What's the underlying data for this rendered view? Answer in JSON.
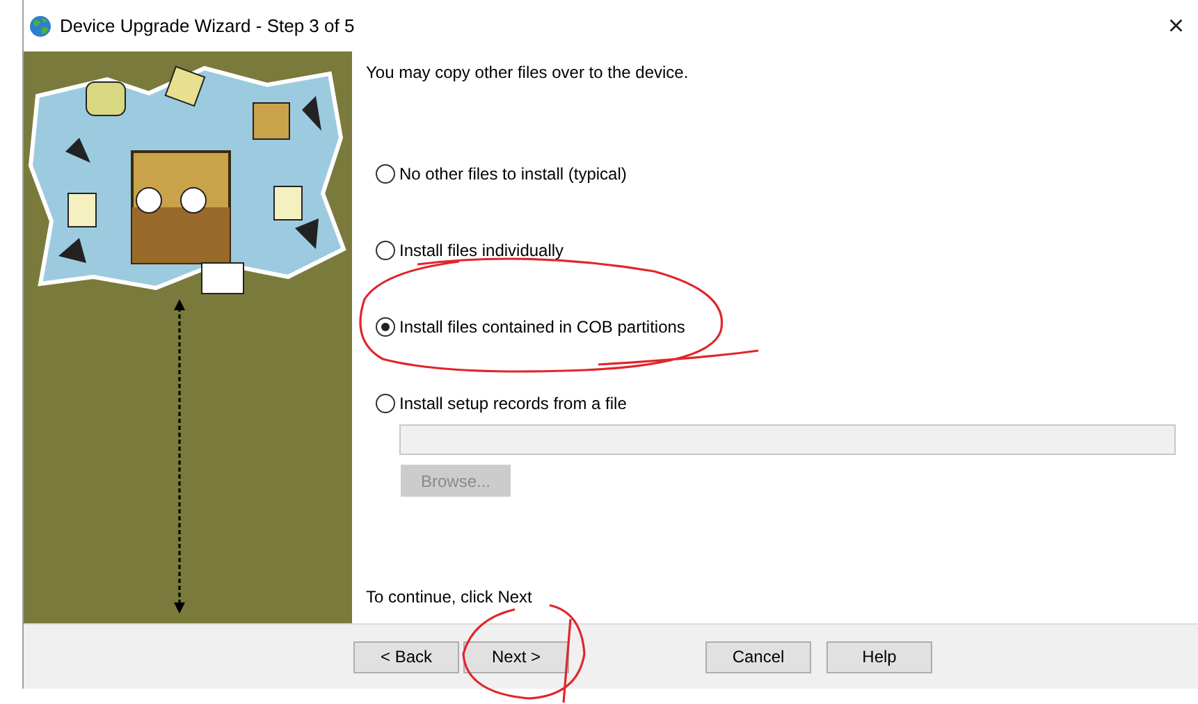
{
  "window": {
    "title": "Device Upgrade Wizard - Step 3 of 5",
    "close": "×"
  },
  "intro": "You may copy other files over to the device.",
  "options": [
    {
      "label": "No other files to install (typical)",
      "selected": false
    },
    {
      "label": "Install files individually",
      "selected": false
    },
    {
      "label": "Install files contained in COB partitions",
      "selected": true
    },
    {
      "label": "Install setup records from a file",
      "selected": false
    }
  ],
  "file_field": {
    "disabled": true
  },
  "browse_button": {
    "label": "Browse...",
    "disabled": true
  },
  "footer_hint": "To continue, click Next",
  "nav_buttons": [
    "< Back",
    "Next >"
  ],
  "action_buttons": [
    "Cancel",
    "Help"
  ]
}
